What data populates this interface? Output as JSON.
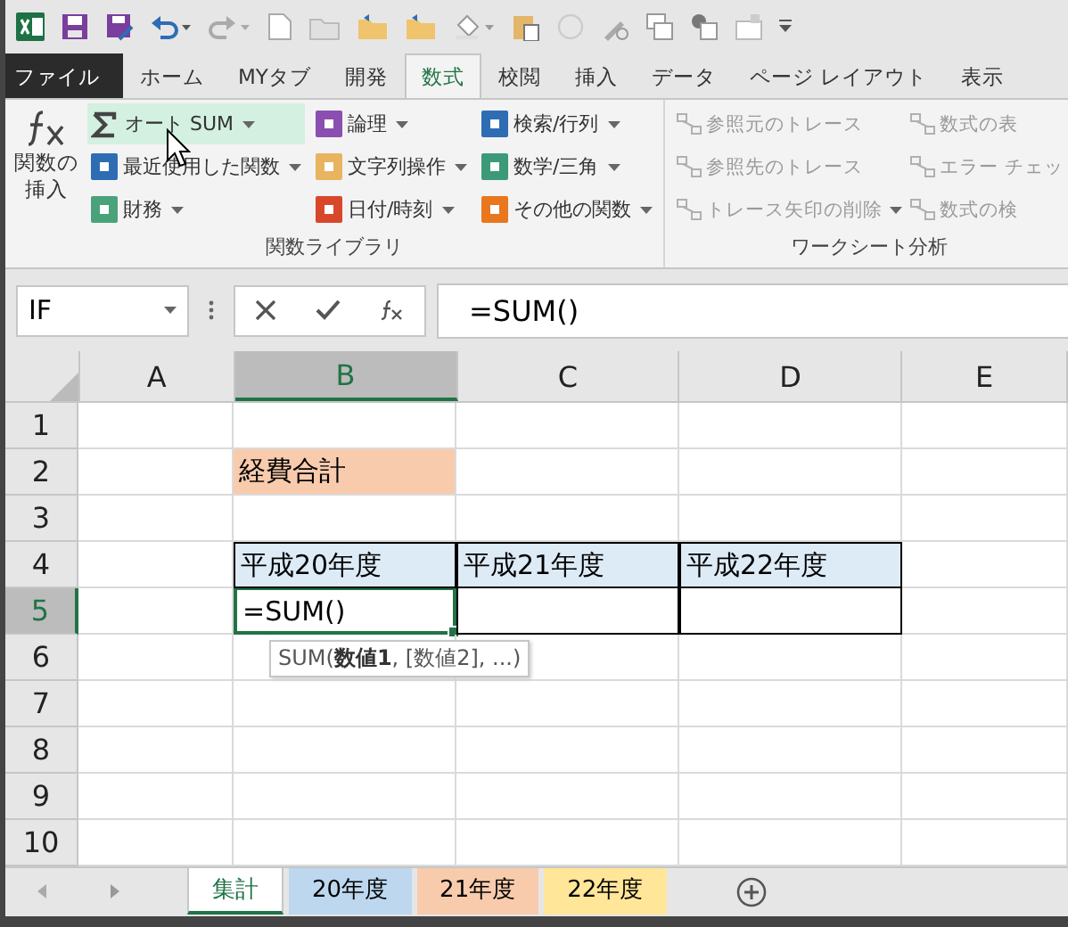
{
  "ribbon_tabs": [
    {
      "label": "ファイル",
      "kind": "file",
      "selected": false
    },
    {
      "label": "ホーム",
      "kind": "tab",
      "selected": false
    },
    {
      "label": "MYタブ",
      "kind": "tab",
      "selected": false
    },
    {
      "label": "開発",
      "kind": "tab",
      "selected": false
    },
    {
      "label": "数式",
      "kind": "tab",
      "selected": true
    },
    {
      "label": "校閲",
      "kind": "tab",
      "selected": false
    },
    {
      "label": "挿入",
      "kind": "tab",
      "selected": false
    },
    {
      "label": "データ",
      "kind": "tab",
      "selected": false
    },
    {
      "label": "ページ レイアウト",
      "kind": "tab",
      "selected": false
    },
    {
      "label": "表示",
      "kind": "tab",
      "selected": false
    }
  ],
  "ribbon_groups": [
    {
      "label": "関数ライブラリ",
      "large_button": {
        "label": "関数の挿入"
      },
      "columns": [
        [
          {
            "label": "オート SUM",
            "kind": "sum",
            "color": "#444444",
            "dropdown": true,
            "hovered": true,
            "disabled": false
          },
          {
            "label": "最近使用した関数",
            "kind": "category",
            "color": "#2e6db4",
            "dropdown": true,
            "hovered": false,
            "disabled": false
          },
          {
            "label": "財務",
            "kind": "category",
            "color": "#4aa27a",
            "dropdown": true,
            "hovered": false,
            "disabled": false
          }
        ],
        [
          {
            "label": "論理",
            "kind": "category",
            "color": "#8a4fb0",
            "dropdown": true,
            "hovered": false,
            "disabled": false
          },
          {
            "label": "文字列操作",
            "kind": "category",
            "color": "#e8b460",
            "dropdown": true,
            "hovered": false,
            "disabled": false
          },
          {
            "label": "日付/時刻",
            "kind": "category",
            "color": "#d9472b",
            "dropdown": true,
            "hovered": false,
            "disabled": false
          }
        ],
        [
          {
            "label": "検索/行列",
            "kind": "category",
            "color": "#2e6db4",
            "dropdown": true,
            "hovered": false,
            "disabled": false
          },
          {
            "label": "数学/三角",
            "kind": "category",
            "color": "#3c9a78",
            "dropdown": true,
            "hovered": false,
            "disabled": false
          },
          {
            "label": "その他の関数",
            "kind": "category",
            "color": "#e8771e",
            "dropdown": true,
            "hovered": false,
            "disabled": false
          }
        ]
      ]
    },
    {
      "label": "ワークシート分析",
      "columns": [
        [
          {
            "label": "参照元のトレース",
            "kind": "trace",
            "color": "#b0b0b0",
            "dropdown": false,
            "hovered": false,
            "disabled": true
          },
          {
            "label": "参照先のトレース",
            "kind": "trace",
            "color": "#b0b0b0",
            "dropdown": false,
            "hovered": false,
            "disabled": true
          },
          {
            "label": "トレース矢印の削除",
            "kind": "trace",
            "color": "#b0b0b0",
            "dropdown": true,
            "hovered": false,
            "disabled": true
          }
        ],
        [
          {
            "label": "数式の表",
            "kind": "trace",
            "color": "#b0b0b0",
            "dropdown": false,
            "hovered": false,
            "disabled": true
          },
          {
            "label": "エラー チェッ",
            "kind": "trace",
            "color": "#b0b0b0",
            "dropdown": false,
            "hovered": false,
            "disabled": true
          },
          {
            "label": "数式の検",
            "kind": "trace",
            "color": "#b0b0b0",
            "dropdown": false,
            "hovered": false,
            "disabled": true
          }
        ]
      ]
    }
  ],
  "name_box": {
    "value": "IF"
  },
  "formula_bar": {
    "value": "=SUM()"
  },
  "columns": [
    {
      "label": "A",
      "selected": false
    },
    {
      "label": "B",
      "selected": true
    },
    {
      "label": "C",
      "selected": false
    },
    {
      "label": "D",
      "selected": false
    },
    {
      "label": "E",
      "selected": false
    }
  ],
  "rows": [
    {
      "header": "1",
      "selected": false,
      "cells": [
        {
          "kind": "empty"
        },
        {
          "kind": "empty"
        },
        {
          "kind": "empty"
        },
        {
          "kind": "empty"
        },
        {
          "kind": "empty"
        }
      ]
    },
    {
      "header": "2",
      "selected": false,
      "cells": [
        {
          "kind": "empty"
        },
        {
          "kind": "title",
          "text": "経費合計",
          "color": "#f8cbad"
        },
        {
          "kind": "empty"
        },
        {
          "kind": "empty"
        },
        {
          "kind": "empty"
        }
      ]
    },
    {
      "header": "3",
      "selected": false,
      "cells": [
        {
          "kind": "empty"
        },
        {
          "kind": "empty"
        },
        {
          "kind": "empty"
        },
        {
          "kind": "empty"
        },
        {
          "kind": "empty"
        }
      ]
    },
    {
      "header": "4",
      "selected": false,
      "cells": [
        {
          "kind": "empty"
        },
        {
          "kind": "header",
          "text": "平成20年度",
          "color": "#ddebf7"
        },
        {
          "kind": "header",
          "text": "平成21年度",
          "color": "#ddebf7"
        },
        {
          "kind": "header",
          "text": "平成22年度",
          "color": "#ddebf7"
        },
        {
          "kind": "empty"
        }
      ]
    },
    {
      "header": "5",
      "selected": true,
      "cells": [
        {
          "kind": "empty"
        },
        {
          "kind": "active",
          "text": "=SUM()"
        },
        {
          "kind": "bordered"
        },
        {
          "kind": "bordered"
        },
        {
          "kind": "empty"
        }
      ]
    },
    {
      "header": "6",
      "selected": false,
      "cells": [
        {
          "kind": "empty"
        },
        {
          "kind": "empty"
        },
        {
          "kind": "empty"
        },
        {
          "kind": "empty"
        },
        {
          "kind": "empty"
        }
      ]
    },
    {
      "header": "7",
      "selected": false,
      "cells": [
        {
          "kind": "empty"
        },
        {
          "kind": "empty"
        },
        {
          "kind": "empty"
        },
        {
          "kind": "empty"
        },
        {
          "kind": "empty"
        }
      ]
    },
    {
      "header": "8",
      "selected": false,
      "cells": [
        {
          "kind": "empty"
        },
        {
          "kind": "empty"
        },
        {
          "kind": "empty"
        },
        {
          "kind": "empty"
        },
        {
          "kind": "empty"
        }
      ]
    },
    {
      "header": "9",
      "selected": false,
      "cells": [
        {
          "kind": "empty"
        },
        {
          "kind": "empty"
        },
        {
          "kind": "empty"
        },
        {
          "kind": "empty"
        },
        {
          "kind": "empty"
        }
      ]
    },
    {
      "header": "10",
      "selected": false,
      "cells": [
        {
          "kind": "empty"
        },
        {
          "kind": "empty"
        },
        {
          "kind": "empty"
        },
        {
          "kind": "empty"
        },
        {
          "kind": "empty"
        }
      ]
    }
  ],
  "function_tooltip": "SUM(**数値1**, [数値2], ...)",
  "sheet_tabs": [
    {
      "label": "集計",
      "selected": true,
      "color": "#ffffff"
    },
    {
      "label": "20年度",
      "selected": false,
      "color": "#bdd7ee"
    },
    {
      "label": "21年度",
      "selected": false,
      "color": "#f8cbad"
    },
    {
      "label": "22年度",
      "selected": false,
      "color": "#ffe699"
    }
  ]
}
